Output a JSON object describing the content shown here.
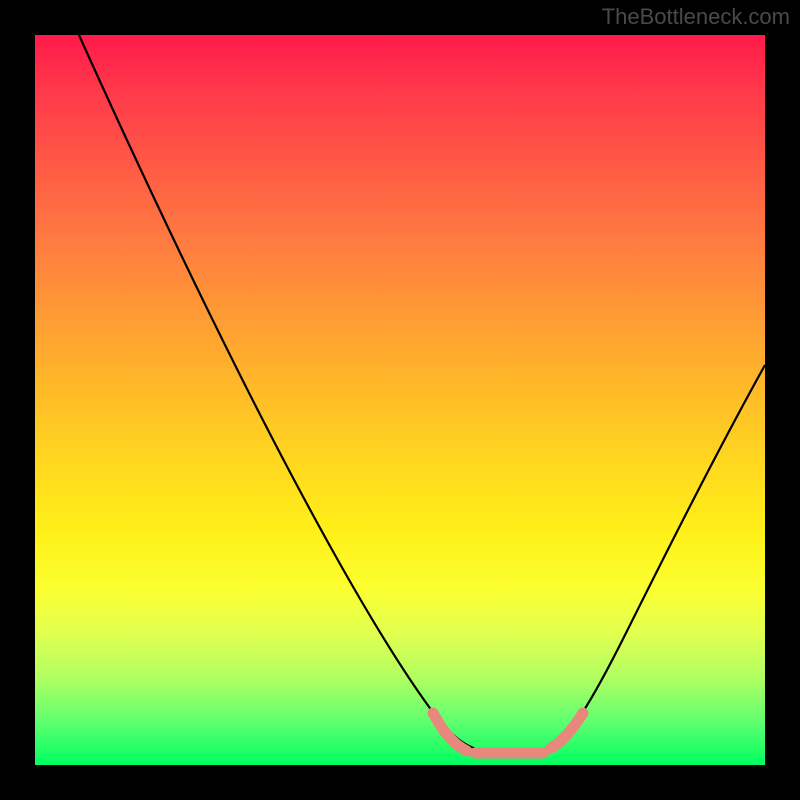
{
  "attribution": "TheBottleneck.com",
  "chart_data": {
    "type": "line",
    "title": "",
    "xlabel": "",
    "ylabel": "",
    "xlim": [
      0,
      100
    ],
    "ylim": [
      0,
      100
    ],
    "series": [
      {
        "name": "curve",
        "color": "#000000",
        "x": [
          6,
          10,
          15,
          20,
          25,
          30,
          35,
          40,
          45,
          50,
          55,
          58,
          60,
          62,
          64,
          66,
          68,
          70,
          72,
          75,
          80,
          85,
          90,
          95,
          100
        ],
        "y": [
          100,
          94,
          86,
          78,
          70,
          62,
          54,
          46,
          38,
          30,
          22,
          15,
          10,
          6,
          3.5,
          2.5,
          2.2,
          2.3,
          3,
          5,
          12,
          22,
          33,
          44,
          55
        ]
      },
      {
        "name": "highlight-band",
        "color": "#e8877c",
        "x": [
          58,
          60,
          62,
          64,
          66,
          68,
          70,
          72,
          74
        ],
        "y": [
          10,
          6,
          4,
          3,
          2.5,
          2.5,
          3,
          4,
          7
        ]
      }
    ],
    "flat_region": {
      "x_start": 60,
      "x_end": 73,
      "y_approx": 2.5
    },
    "gradient_stops": [
      {
        "pos": 0,
        "color": "#ff1a4a"
      },
      {
        "pos": 50,
        "color": "#ffd620"
      },
      {
        "pos": 100,
        "color": "#00ff60"
      }
    ]
  }
}
